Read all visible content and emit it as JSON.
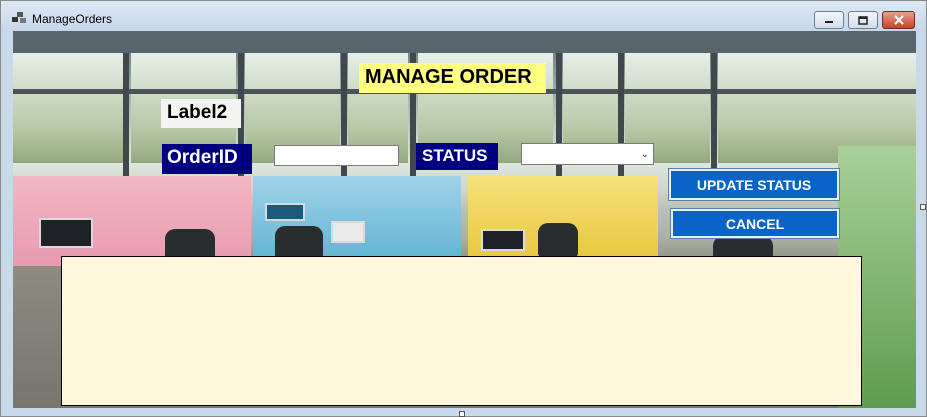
{
  "window": {
    "title": "ManageOrders",
    "icon": "app-window-icon",
    "controls": {
      "minimize": "minimize-icon",
      "maximize": "restore-icon",
      "close": "close-icon"
    }
  },
  "form": {
    "header_label": "MANAGE ORDER",
    "label2": "Label2",
    "orderid_label": "OrderID",
    "orderid_value": "",
    "status_label": "STATUS",
    "status_selected": "",
    "update_button": "UPDATE STATUS",
    "cancel_button": "CANCEL"
  },
  "colors": {
    "header_bg": "#ffff80",
    "label_navy": "#000080",
    "button_blue": "#0a64c8",
    "grid_bg": "#fff7dc",
    "close_red": "#c6422a"
  }
}
